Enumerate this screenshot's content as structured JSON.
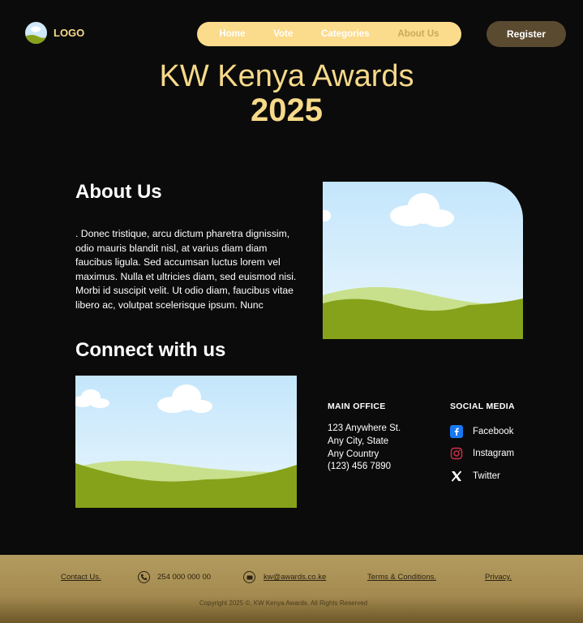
{
  "header": {
    "logo_text": "LOGO",
    "nav": [
      {
        "label": "Home",
        "active": false
      },
      {
        "label": "Vote",
        "active": false
      },
      {
        "label": "Categories",
        "active": false
      },
      {
        "label": "About Us",
        "active": true
      }
    ],
    "register_label": "Register"
  },
  "hero": {
    "title": "KW Kenya Awards",
    "year": "2025"
  },
  "about": {
    "heading": "About Us",
    "text": ". Donec tristique, arcu dictum pharetra dignissim, odio mauris blandit nisl, at varius diam diam faucibus ligula. Sed accumsan luctus lorem vel maximus. Nulla et ultricies diam, sed euismod nisi. Morbi id suscipit velit. Ut odio diam, faucibus vitae libero ac, volutpat scelerisque ipsum. Nunc"
  },
  "connect": {
    "heading": "Connect with us",
    "office": {
      "heading": "MAIN OFFICE",
      "lines": [
        "123 Anywhere St.",
        "Any City, State",
        "Any Country",
        "(123) 456 7890"
      ]
    },
    "social": {
      "heading": "SOCIAL MEDIA",
      "items": [
        {
          "label": "Facebook",
          "icon": "facebook-icon"
        },
        {
          "label": "Instagram",
          "icon": "instagram-icon"
        },
        {
          "label": "Twitter",
          "icon": "twitter-x-icon"
        }
      ]
    }
  },
  "footer": {
    "contact": "Contact Us.",
    "phone": "254 000 000 00",
    "email": "kw@awards.co.ke",
    "terms": "Terms & Conditions.",
    "privacy": "Privacy.",
    "copyright": "Copyright 2025 ©, KW Kenya Awards.  All Rights Reserved"
  },
  "colors": {
    "accent_gold": "#f7d98a",
    "nav_bg": "#fbdc8c",
    "register_bg": "#5a4a30",
    "page_bg": "#0b0b0b",
    "footer_bg": "#b39b5f"
  }
}
